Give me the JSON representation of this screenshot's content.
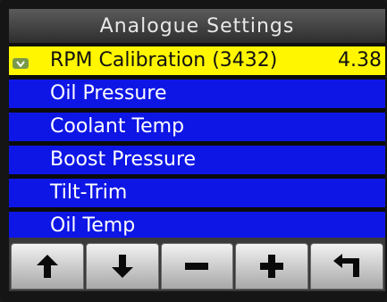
{
  "screen": {
    "title": "Analogue Settings"
  },
  "menu": {
    "items": [
      {
        "label": "RPM Calibration (3432)",
        "value": "4.38",
        "selected": true
      },
      {
        "label": "Oil Pressure",
        "value": "",
        "selected": false
      },
      {
        "label": "Coolant Temp",
        "value": "",
        "selected": false
      },
      {
        "label": "Boost Pressure",
        "value": "",
        "selected": false
      },
      {
        "label": "Tilt-Trim",
        "value": "",
        "selected": false
      },
      {
        "label": "Oil Temp",
        "value": "",
        "selected": false
      }
    ]
  },
  "buttons": [
    {
      "icon": "arrow-up-icon"
    },
    {
      "icon": "arrow-down-icon"
    },
    {
      "icon": "minus-icon"
    },
    {
      "icon": "plus-icon"
    },
    {
      "icon": "back-icon"
    }
  ],
  "colors": {
    "item_background": "#0e16e6",
    "selected_background": "#fff600",
    "item_text": "#ffffff",
    "selected_text": "#111111"
  }
}
